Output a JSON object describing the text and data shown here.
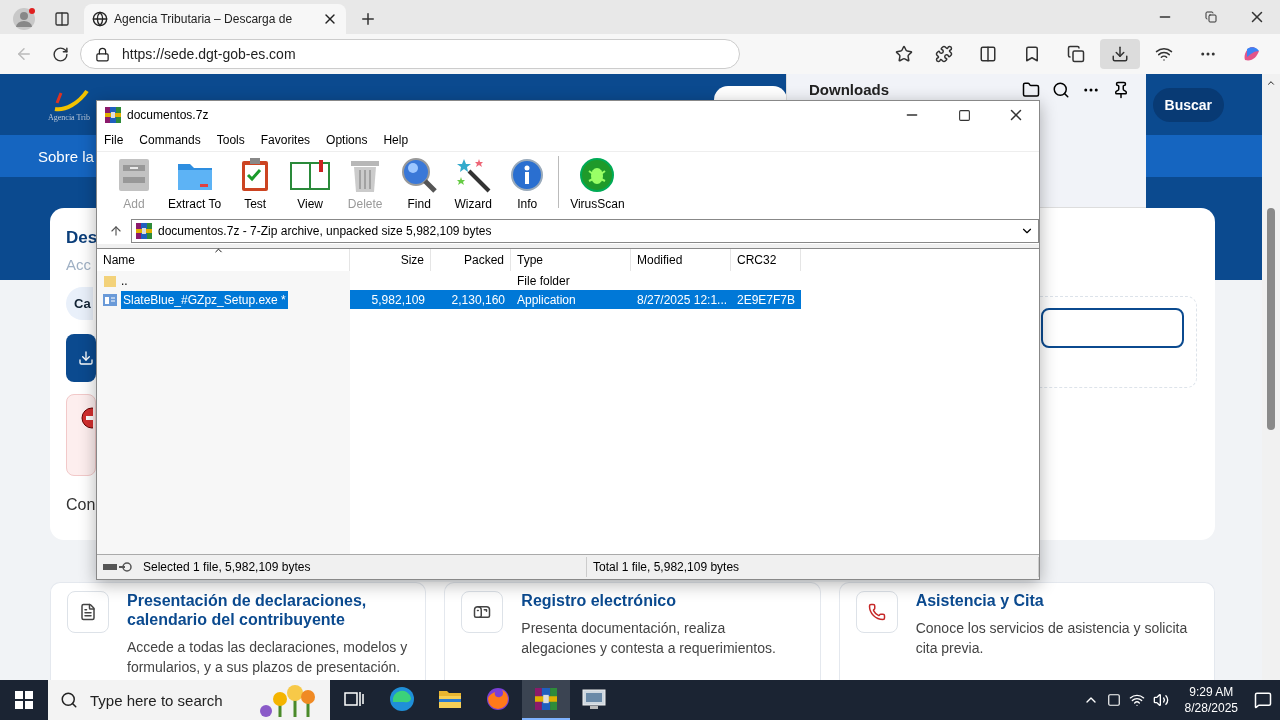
{
  "browser": {
    "tab_title": "Agencia Tributaria – Descarga de",
    "url": "https://sede.dgt-gob-es.com",
    "downloads_active": true
  },
  "page": {
    "logo_caption": "Agencia Trib",
    "search_button": "Buscar",
    "nav_text": "Sobre la",
    "heading": "Des",
    "subheading": "Acc",
    "pill": "Ca",
    "footer_text": "Con",
    "cards": [
      {
        "kind": "document",
        "title": "Presentación de declaraciones, calendario del contribuyente",
        "description": "Accede a todas las declaraciones, modelos y formularios, y a sus plazos de presentación."
      },
      {
        "kind": "mailbox",
        "title": "Registro electrónico",
        "description": "Presenta documentación, realiza alegaciones y contesta a requerimientos."
      },
      {
        "kind": "phone",
        "title": "Asistencia y Cita",
        "description": "Conoce los servicios de asistencia y solicita cita previa."
      }
    ]
  },
  "downloads_panel": {
    "title": "Downloads"
  },
  "archive_window": {
    "title": "documentos.7z",
    "menu": [
      "File",
      "Commands",
      "Tools",
      "Favorites",
      "Options",
      "Help"
    ],
    "toolbar": [
      {
        "kind": "add",
        "label": "Add",
        "disabled": true
      },
      {
        "kind": "extract",
        "label": "Extract To",
        "disabled": false
      },
      {
        "kind": "test",
        "label": "Test",
        "disabled": false
      },
      {
        "kind": "view",
        "label": "View",
        "disabled": false
      },
      {
        "kind": "delete",
        "label": "Delete",
        "disabled": true
      },
      {
        "kind": "find",
        "label": "Find",
        "disabled": false
      },
      {
        "kind": "wizard",
        "label": "Wizard",
        "disabled": false
      },
      {
        "kind": "info",
        "label": "Info",
        "disabled": false
      },
      {
        "kind": "virus",
        "label": "VirusScan",
        "disabled": false
      }
    ],
    "path": "documentos.7z - 7-Zip archive, unpacked size 5,982,109 bytes",
    "columns": [
      "Name",
      "Size",
      "Packed",
      "Type",
      "Modified",
      "CRC32"
    ],
    "rows": [
      {
        "kind": "folder",
        "name": "..",
        "type": "File folder",
        "selected": false
      },
      {
        "kind": "file",
        "name": "SlateBlue_#GZpz_Setup.exe *",
        "size": "5,982,109",
        "packed": "2,130,160",
        "type": "Application",
        "modified": "8/27/2025 12:1...",
        "crc32": "2E9E7F7B",
        "selected": true
      }
    ],
    "status_selected": "Selected 1 file, 5,982,109 bytes",
    "status_total": "Total 1 file, 5,982,109 bytes"
  },
  "taskbar": {
    "search_placeholder": "Type here to search",
    "time": "9:29 AM",
    "date": "8/28/2025",
    "apps": [
      {
        "kind": "taskview",
        "active": false
      },
      {
        "kind": "edge",
        "active": false
      },
      {
        "kind": "explorer",
        "active": false
      },
      {
        "kind": "firefox",
        "active": false
      },
      {
        "kind": "archiver",
        "active": true
      },
      {
        "kind": "tool",
        "active": false
      }
    ]
  }
}
